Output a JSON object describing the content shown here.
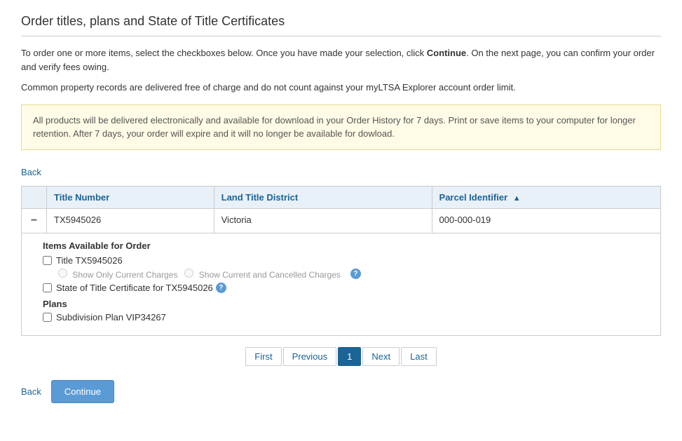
{
  "page": {
    "title": "Order titles, plans and State of Title Certificates",
    "description1": "To order one or more items, select the checkboxes below. Once you have made your selection, click ",
    "description_bold": "Continue",
    "description2": ". On the next page, you can confirm your order and verify fees owing.",
    "description3": "Common property records are delivered free of charge and do not count against your myLTSA Explorer account order limit.",
    "notice": "All products will be delivered electronically and available for download in your Order History for 7 days. Print or save items to your computer for longer retention. After 7 days, your order will expire and it will no longer be available for dowload.",
    "back_link": "Back"
  },
  "table": {
    "headers": {
      "title_number": "Title Number",
      "land_title_district": "Land Title District",
      "parcel_identifier": "Parcel Identifier"
    },
    "rows": [
      {
        "title_number": "TX5945026",
        "land_title_district": "Victoria",
        "parcel_identifier": "000-000-019"
      }
    ]
  },
  "items_available": {
    "heading": "Items Available for Order",
    "checkboxes": [
      {
        "label": "Title TX5945026",
        "checked": false
      },
      {
        "label": "State of Title Certificate for TX5945026",
        "checked": false
      }
    ],
    "radio_options": [
      {
        "label": "Show Only Current Charges",
        "disabled": true
      },
      {
        "label": "Show Current and Cancelled Charges",
        "disabled": true
      }
    ],
    "plans_heading": "Plans",
    "plans_checkboxes": [
      {
        "label": "Subdivision Plan VIP34267",
        "checked": false
      }
    ]
  },
  "pagination": {
    "first": "First",
    "previous": "Previous",
    "current": "1",
    "next": "Next",
    "last": "Last"
  },
  "footer": {
    "back_label": "Back",
    "continue_label": "Continue"
  }
}
